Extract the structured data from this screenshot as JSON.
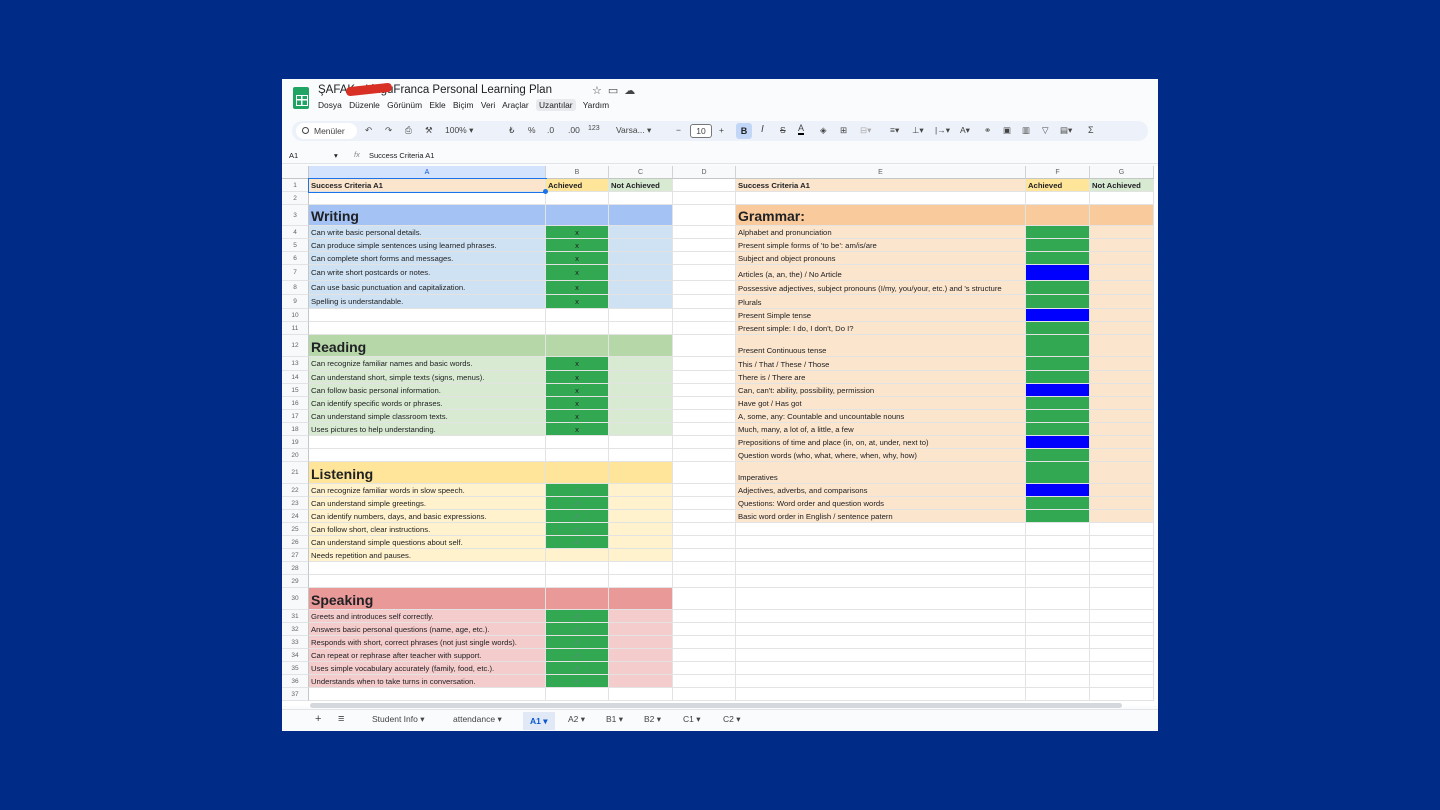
{
  "title": {
    "text": "ŞAFAK        - LinguFranca Personal Learning Plan"
  },
  "menu": [
    "Dosya",
    "Düzenle",
    "Görünüm",
    "Ekle",
    "Biçim",
    "Veri",
    "Araçlar",
    "Uzantılar",
    "Yardım"
  ],
  "toolbar": {
    "search": "Menüler",
    "zoom": "100%",
    "currency": "₺",
    "percent": "%",
    "dec_minus": ".0",
    "dec_plus": ".00",
    "number_fmt": "123",
    "font": "Varsa...",
    "font_size": "10",
    "bold": "B",
    "italic": "I",
    "strike": "S",
    "text_color": "A",
    "sum": "Σ"
  },
  "formula": {
    "ref": "A1",
    "fx": "fx",
    "content": "Success Criteria A1"
  },
  "columns": [
    "A",
    "B",
    "C",
    "D",
    "E",
    "F",
    "G"
  ],
  "rows": [
    "1",
    "2",
    "3",
    "4",
    "5",
    "6",
    "7",
    "8",
    "9",
    "10",
    "11",
    "12",
    "13",
    "14",
    "15",
    "16",
    "17",
    "18",
    "19",
    "20",
    "21",
    "22",
    "23",
    "24",
    "25",
    "26",
    "27",
    "28",
    "29",
    "30",
    "31",
    "32",
    "33",
    "34",
    "35",
    "36",
    "37"
  ],
  "colors": {
    "writing_header": "#a4c2f4",
    "writing_row": "#cfe2f3",
    "reading_header": "#b6d7a8",
    "reading_row": "#d9ead3",
    "listening_header": "#ffe599",
    "listening_row": "#fff2cc",
    "speaking_header": "#ea9999",
    "speaking_row": "#f4cccc",
    "grammar_header": "#f9cb9c",
    "grammar_row": "#fce5cd",
    "achieved": "#33a852",
    "blue": "#0000ff"
  },
  "left": {
    "header": {
      "criteria": "Success Criteria A1",
      "achieved": "Achieved",
      "not_achieved": "Not Achieved"
    },
    "writing": {
      "title": "Writing",
      "items": [
        "Can write basic personal details.",
        "Can produce simple sentences using learned phrases.",
        "Can complete short forms and messages.",
        "Can write short postcards or notes.",
        "Can use basic punctuation and capitalization.",
        "Spelling is understandable."
      ],
      "mark": "x"
    },
    "reading": {
      "title": "Reading",
      "items": [
        "Can recognize familiar names and basic words.",
        "Can understand short, simple texts (signs, menus).",
        "Can follow basic personal information.",
        "Can identify specific words or phrases.",
        "Can understand simple classroom texts.",
        "Uses pictures to help understanding."
      ],
      "mark": "x"
    },
    "listening": {
      "title": "Listening",
      "items": [
        "Can recognize familiar words in slow speech.",
        "Can understand simple greetings.",
        "Can identify numbers, days, and basic expressions.",
        "Can follow short, clear instructions.",
        "Can understand simple questions about self.",
        "Needs repetition and pauses."
      ],
      "mark": "✓"
    },
    "speaking": {
      "title": "Speaking",
      "items": [
        "Greets and introduces self correctly.",
        "Answers basic personal questions (name, age, etc.).",
        "Responds with short, correct phrases (not just single words).",
        "Can repeat or rephrase after teacher with support.",
        "Uses simple vocabulary accurately (family, food, etc.).",
        "Understands when to take turns in conversation."
      ],
      "mark": "✓"
    }
  },
  "right": {
    "header": {
      "criteria": "Success Criteria A1",
      "achieved": "Achieved",
      "not_achieved": "Not Achieved"
    },
    "grammar": {
      "title": "Grammar:",
      "items": [
        "Alphabet and pronunciation",
        "Present simple forms of 'to be': am/is/are",
        "Subject and object pronouns",
        "Articles (a, an, the) / No Article",
        "Possessive adjectives, subject pronouns (I/my, you/your, etc.) and 's structure",
        "Plurals",
        "Present Simple tense",
        "Present simple: I do, I don't, Do I?",
        "Present Continuous tense",
        "This / That / These / Those",
        "There is / There are",
        "Can, can't: ability, possibility, permission",
        "Have got / Has got",
        "A, some, any: Countable and uncountable nouns",
        "Much, many, a lot of, a little, a few",
        "Prepositions of time and place (in, on, at, under, next to)",
        "Question words (who, what, where, when, why, how)",
        "Imperatives",
        "Adjectives, adverbs, and comparisons",
        "Questions: Word order and question words",
        "Basic word order in English / sentence patern"
      ]
    }
  },
  "sheets": [
    "Student Info",
    "attendance",
    "A1",
    "A2",
    "B1",
    "B2",
    "C1",
    "C2"
  ],
  "active_sheet": "A1"
}
